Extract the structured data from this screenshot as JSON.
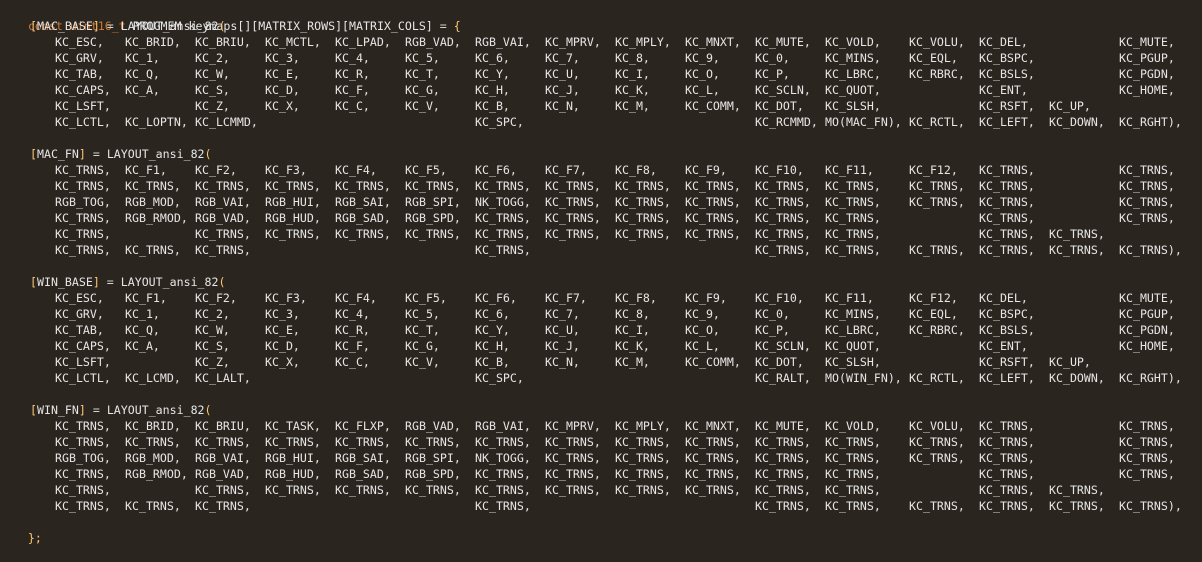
{
  "declaration": {
    "keyword": "const",
    "type": "uint16_t",
    "name": "PROGMEM keymaps",
    "dims": "[][MATRIX_ROWS][MATRIX_COLS]",
    "eq": "=",
    "open": "{",
    "close": "};"
  },
  "layout_macro": "LAYOUT_ansi_82",
  "layers": [
    {
      "name": "MAC_BASE",
      "rows": [
        [
          "KC_ESC,",
          "KC_BRID,",
          "KC_BRIU,",
          "KC_MCTL,",
          "KC_LPAD,",
          "RGB_VAD,",
          "RGB_VAI,",
          "KC_MPRV,",
          "KC_MPLY,",
          "KC_MNXT,",
          "KC_MUTE,",
          "KC_VOLD,",
          "KC_VOLU,",
          "KC_DEL,",
          "",
          "KC_MUTE,"
        ],
        [
          "KC_GRV,",
          "KC_1,",
          "KC_2,",
          "KC_3,",
          "KC_4,",
          "KC_5,",
          "KC_6,",
          "KC_7,",
          "KC_8,",
          "KC_9,",
          "KC_0,",
          "KC_MINS,",
          "KC_EQL,",
          "KC_BSPC,",
          "",
          "KC_PGUP,"
        ],
        [
          "KC_TAB,",
          "KC_Q,",
          "KC_W,",
          "KC_E,",
          "KC_R,",
          "KC_T,",
          "KC_Y,",
          "KC_U,",
          "KC_I,",
          "KC_O,",
          "KC_P,",
          "KC_LBRC,",
          "KC_RBRC,",
          "KC_BSLS,",
          "",
          "KC_PGDN,"
        ],
        [
          "KC_CAPS,",
          "KC_A,",
          "KC_S,",
          "KC_D,",
          "KC_F,",
          "KC_G,",
          "KC_H,",
          "KC_J,",
          "KC_K,",
          "KC_L,",
          "KC_SCLN,",
          "KC_QUOT,",
          "",
          "KC_ENT,",
          "",
          "KC_HOME,"
        ],
        [
          "KC_LSFT,",
          "",
          "KC_Z,",
          "KC_X,",
          "KC_C,",
          "KC_V,",
          "KC_B,",
          "KC_N,",
          "KC_M,",
          "KC_COMM,",
          "KC_DOT,",
          "KC_SLSH,",
          "",
          "KC_RSFT,",
          "KC_UP,",
          ""
        ],
        [
          "KC_LCTL,",
          "KC_LOPTN,",
          "KC_LCMMD,",
          "",
          "",
          "",
          "KC_SPC,",
          "",
          "",
          "",
          "KC_RCMMD,",
          "MO(MAC_FN),",
          "KC_RCTL,",
          "KC_LEFT,",
          "KC_DOWN,",
          "KC_RGHT),"
        ]
      ]
    },
    {
      "name": "MAC_FN",
      "rows": [
        [
          "KC_TRNS,",
          "KC_F1,",
          "KC_F2,",
          "KC_F3,",
          "KC_F4,",
          "KC_F5,",
          "KC_F6,",
          "KC_F7,",
          "KC_F8,",
          "KC_F9,",
          "KC_F10,",
          "KC_F11,",
          "KC_F12,",
          "KC_TRNS,",
          "",
          "KC_TRNS,"
        ],
        [
          "KC_TRNS,",
          "KC_TRNS,",
          "KC_TRNS,",
          "KC_TRNS,",
          "KC_TRNS,",
          "KC_TRNS,",
          "KC_TRNS,",
          "KC_TRNS,",
          "KC_TRNS,",
          "KC_TRNS,",
          "KC_TRNS,",
          "KC_TRNS,",
          "KC_TRNS,",
          "KC_TRNS,",
          "",
          "KC_TRNS,"
        ],
        [
          "RGB_TOG,",
          "RGB_MOD,",
          "RGB_VAI,",
          "RGB_HUI,",
          "RGB_SAI,",
          "RGB_SPI,",
          "NK_TOGG,",
          "KC_TRNS,",
          "KC_TRNS,",
          "KC_TRNS,",
          "KC_TRNS,",
          "KC_TRNS,",
          "KC_TRNS,",
          "KC_TRNS,",
          "",
          "KC_TRNS,"
        ],
        [
          "KC_TRNS,",
          "RGB_RMOD,",
          "RGB_VAD,",
          "RGB_HUD,",
          "RGB_SAD,",
          "RGB_SPD,",
          "KC_TRNS,",
          "KC_TRNS,",
          "KC_TRNS,",
          "KC_TRNS,",
          "KC_TRNS,",
          "KC_TRNS,",
          "",
          "KC_TRNS,",
          "",
          "KC_TRNS,"
        ],
        [
          "KC_TRNS,",
          "",
          "KC_TRNS,",
          "KC_TRNS,",
          "KC_TRNS,",
          "KC_TRNS,",
          "KC_TRNS,",
          "KC_TRNS,",
          "KC_TRNS,",
          "KC_TRNS,",
          "KC_TRNS,",
          "KC_TRNS,",
          "",
          "KC_TRNS,",
          "KC_TRNS,",
          ""
        ],
        [
          "KC_TRNS,",
          "KC_TRNS,",
          "KC_TRNS,",
          "",
          "",
          "",
          "KC_TRNS,",
          "",
          "",
          "",
          "KC_TRNS,",
          "KC_TRNS,",
          "KC_TRNS,",
          "KC_TRNS,",
          "KC_TRNS,",
          "KC_TRNS),"
        ]
      ]
    },
    {
      "name": "WIN_BASE",
      "rows": [
        [
          "KC_ESC,",
          "KC_F1,",
          "KC_F2,",
          "KC_F3,",
          "KC_F4,",
          "KC_F5,",
          "KC_F6,",
          "KC_F7,",
          "KC_F8,",
          "KC_F9,",
          "KC_F10,",
          "KC_F11,",
          "KC_F12,",
          "KC_DEL,",
          "",
          "KC_MUTE,"
        ],
        [
          "KC_GRV,",
          "KC_1,",
          "KC_2,",
          "KC_3,",
          "KC_4,",
          "KC_5,",
          "KC_6,",
          "KC_7,",
          "KC_8,",
          "KC_9,",
          "KC_0,",
          "KC_MINS,",
          "KC_EQL,",
          "KC_BSPC,",
          "",
          "KC_PGUP,"
        ],
        [
          "KC_TAB,",
          "KC_Q,",
          "KC_W,",
          "KC_E,",
          "KC_R,",
          "KC_T,",
          "KC_Y,",
          "KC_U,",
          "KC_I,",
          "KC_O,",
          "KC_P,",
          "KC_LBRC,",
          "KC_RBRC,",
          "KC_BSLS,",
          "",
          "KC_PGDN,"
        ],
        [
          "KC_CAPS,",
          "KC_A,",
          "KC_S,",
          "KC_D,",
          "KC_F,",
          "KC_G,",
          "KC_H,",
          "KC_J,",
          "KC_K,",
          "KC_L,",
          "KC_SCLN,",
          "KC_QUOT,",
          "",
          "KC_ENT,",
          "",
          "KC_HOME,"
        ],
        [
          "KC_LSFT,",
          "",
          "KC_Z,",
          "KC_X,",
          "KC_C,",
          "KC_V,",
          "KC_B,",
          "KC_N,",
          "KC_M,",
          "KC_COMM,",
          "KC_DOT,",
          "KC_SLSH,",
          "",
          "KC_RSFT,",
          "KC_UP,",
          ""
        ],
        [
          "KC_LCTL,",
          "KC_LCMD,",
          "KC_LALT,",
          "",
          "",
          "",
          "KC_SPC,",
          "",
          "",
          "",
          "KC_RALT,",
          "MO(WIN_FN),",
          "KC_RCTL,",
          "KC_LEFT,",
          "KC_DOWN,",
          "KC_RGHT),"
        ]
      ]
    },
    {
      "name": "WIN_FN",
      "rows": [
        [
          "KC_TRNS,",
          "KC_BRID,",
          "KC_BRIU,",
          "KC_TASK,",
          "KC_FLXP,",
          "RGB_VAD,",
          "RGB_VAI,",
          "KC_MPRV,",
          "KC_MPLY,",
          "KC_MNXT,",
          "KC_MUTE,",
          "KC_VOLD,",
          "KC_VOLU,",
          "KC_TRNS,",
          "",
          "KC_TRNS,"
        ],
        [
          "KC_TRNS,",
          "KC_TRNS,",
          "KC_TRNS,",
          "KC_TRNS,",
          "KC_TRNS,",
          "KC_TRNS,",
          "KC_TRNS,",
          "KC_TRNS,",
          "KC_TRNS,",
          "KC_TRNS,",
          "KC_TRNS,",
          "KC_TRNS,",
          "KC_TRNS,",
          "KC_TRNS,",
          "",
          "KC_TRNS,"
        ],
        [
          "RGB_TOG,",
          "RGB_MOD,",
          "RGB_VAI,",
          "RGB_HUI,",
          "RGB_SAI,",
          "RGB_SPI,",
          "NK_TOGG,",
          "KC_TRNS,",
          "KC_TRNS,",
          "KC_TRNS,",
          "KC_TRNS,",
          "KC_TRNS,",
          "KC_TRNS,",
          "KC_TRNS,",
          "",
          "KC_TRNS,"
        ],
        [
          "KC_TRNS,",
          "RGB_RMOD,",
          "RGB_VAD,",
          "RGB_HUD,",
          "RGB_SAD,",
          "RGB_SPD,",
          "KC_TRNS,",
          "KC_TRNS,",
          "KC_TRNS,",
          "KC_TRNS,",
          "KC_TRNS,",
          "KC_TRNS,",
          "",
          "KC_TRNS,",
          "",
          "KC_TRNS,"
        ],
        [
          "KC_TRNS,",
          "",
          "KC_TRNS,",
          "KC_TRNS,",
          "KC_TRNS,",
          "KC_TRNS,",
          "KC_TRNS,",
          "KC_TRNS,",
          "KC_TRNS,",
          "KC_TRNS,",
          "KC_TRNS,",
          "KC_TRNS,",
          "",
          "KC_TRNS,",
          "KC_TRNS,",
          ""
        ],
        [
          "KC_TRNS,",
          "KC_TRNS,",
          "KC_TRNS,",
          "",
          "",
          "",
          "KC_TRNS,",
          "",
          "",
          "",
          "KC_TRNS,",
          "KC_TRNS,",
          "KC_TRNS,",
          "KC_TRNS,",
          "KC_TRNS,",
          "KC_TRNS),"
        ]
      ]
    }
  ],
  "colors": {
    "background": "#2b2520",
    "keyword": "#cc7832",
    "bracket": "#ffc66d",
    "text": "#e6e6e6"
  }
}
